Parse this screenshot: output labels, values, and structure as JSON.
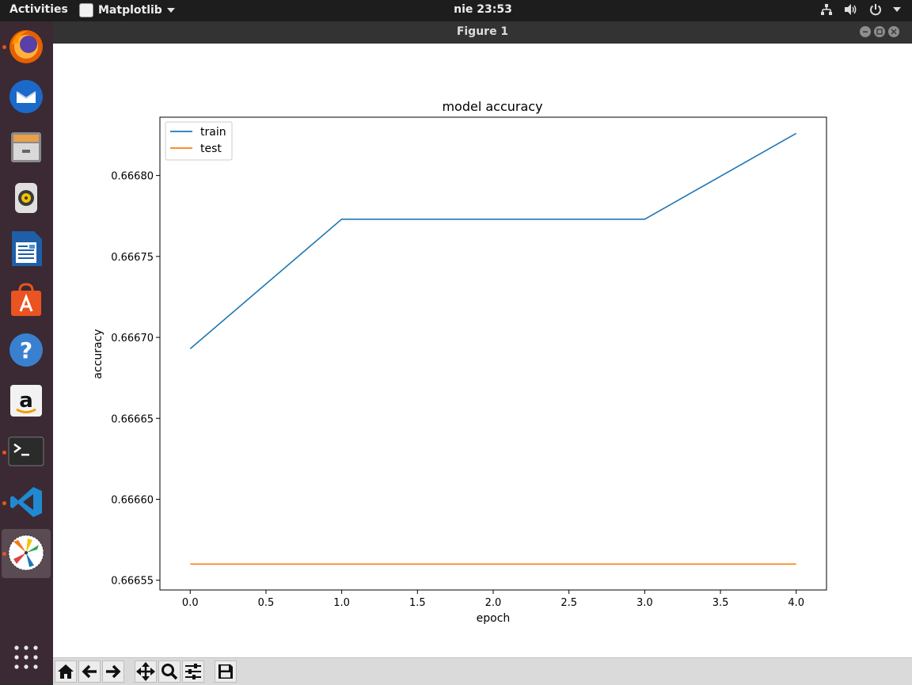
{
  "topbar": {
    "activities": "Activities",
    "app_name": "Matplotlib",
    "clock": "nie 23:53"
  },
  "window": {
    "title": "Figure 1"
  },
  "chart_data": {
    "type": "line",
    "title": "model accuracy",
    "xlabel": "epoch",
    "ylabel": "accuracy",
    "x": [
      0,
      1,
      2,
      3,
      4
    ],
    "xlim": [
      -0.2,
      4.2
    ],
    "ylim": [
      0.666544,
      0.666836
    ],
    "xticks": [
      0.0,
      0.5,
      1.0,
      1.5,
      2.0,
      2.5,
      3.0,
      3.5,
      4.0
    ],
    "xtick_labels": [
      "0.0",
      "0.5",
      "1.0",
      "1.5",
      "2.0",
      "2.5",
      "3.0",
      "3.5",
      "4.0"
    ],
    "yticks": [
      0.66655,
      0.6666,
      0.66665,
      0.6667,
      0.66675,
      0.6668
    ],
    "ytick_labels": [
      "0.66655",
      "0.66660",
      "0.66665",
      "0.66670",
      "0.66675",
      "0.66680"
    ],
    "legend_position": "top-left",
    "series": [
      {
        "name": "train",
        "color": "#1f77b4",
        "values": [
          0.666693,
          0.666773,
          0.666773,
          0.666773,
          0.666826
        ]
      },
      {
        "name": "test",
        "color": "#ff7f0e",
        "values": [
          0.66656,
          0.66656,
          0.66656,
          0.66656,
          0.66656
        ]
      }
    ]
  }
}
